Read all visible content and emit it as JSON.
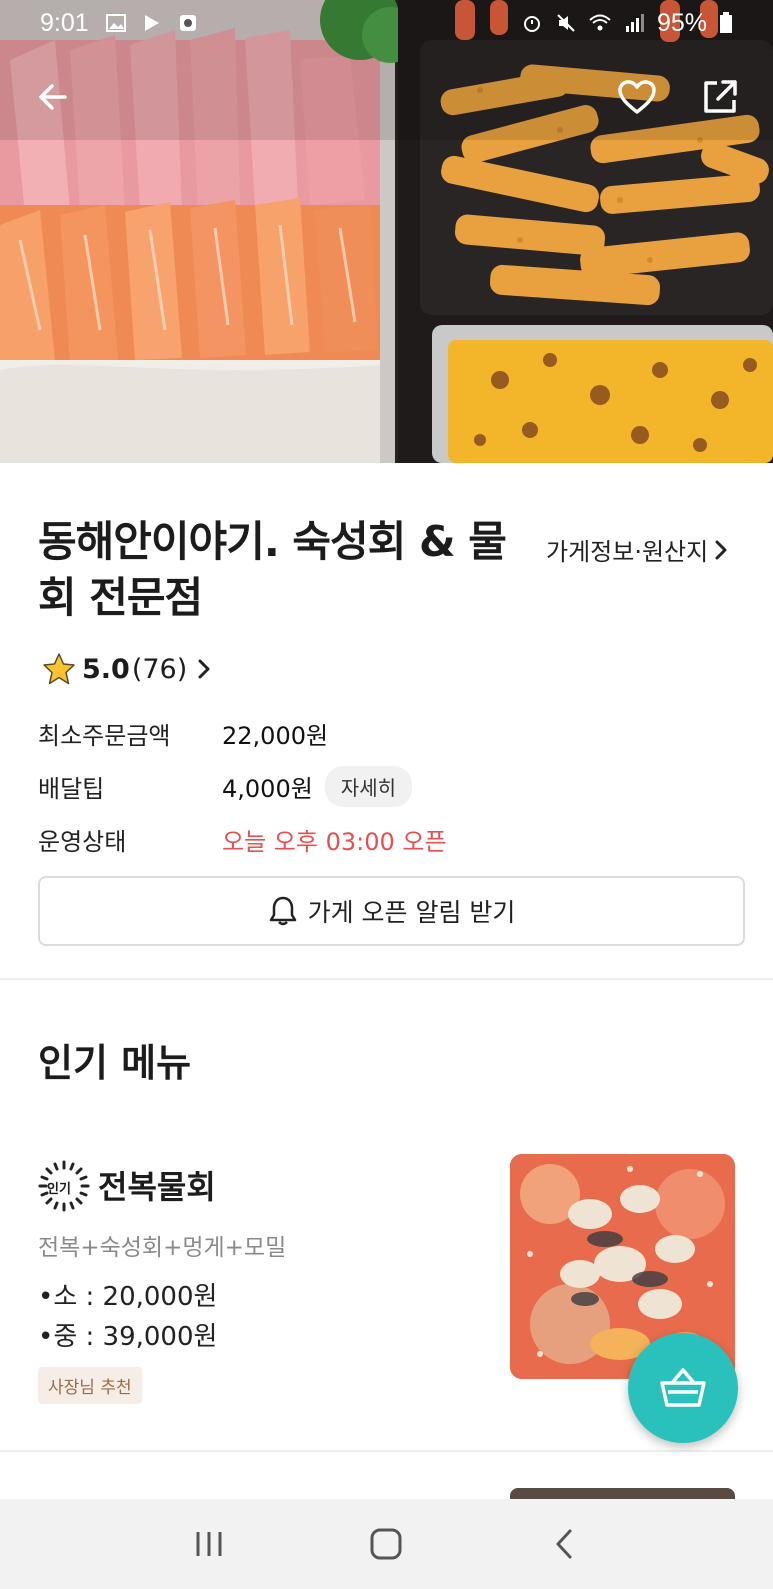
{
  "status_bar": {
    "time": "9:01",
    "battery": "95%"
  },
  "store": {
    "name": "동해안이야기. 숙성회 & 물회 전문점",
    "info_link": "가게정보·원산지",
    "rating": {
      "score": "5.0",
      "count": "(76)"
    }
  },
  "info_rows": {
    "min_order_label": "최소주문금액",
    "min_order_value": "22,000원",
    "delivery_tip_label": "배달팁",
    "delivery_tip_value": "4,000원",
    "delivery_tip_detail": "자세히",
    "operation_label": "운영상태",
    "operation_value": "오늘 오후 03:00 오픈"
  },
  "notify_button": "가게 오픈 알림 받기",
  "popular_section": {
    "title": "인기 메뉴",
    "items": [
      {
        "badge": "인기",
        "name": "전복물회",
        "description": "전복+숙성회+멍게+모밀",
        "prices": [
          "•소 : 20,000원",
          "•중 : 39,000원"
        ],
        "tag": "사장님 추천"
      }
    ]
  },
  "colors": {
    "accent": "#2ac1bc",
    "status_red": "#e3504f",
    "tag_bg": "#f6eee6",
    "tag_text": "#9a6b4a"
  },
  "icons": [
    "back-arrow-icon",
    "heart-icon",
    "share-icon",
    "star-icon",
    "chevron-right-icon",
    "bell-icon",
    "popular-badge-icon",
    "basket-icon",
    "recents-icon",
    "home-icon",
    "nav-back-icon"
  ]
}
